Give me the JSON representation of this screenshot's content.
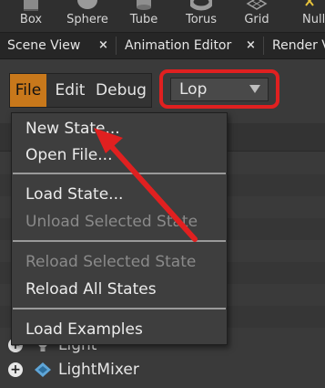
{
  "shelf": {
    "tools": [
      {
        "label": "Box",
        "icon": "box-icon"
      },
      {
        "label": "Sphere",
        "icon": "sphere-icon"
      },
      {
        "label": "Tube",
        "icon": "tube-icon"
      },
      {
        "label": "Torus",
        "icon": "torus-icon"
      },
      {
        "label": "Grid",
        "icon": "grid-icon"
      },
      {
        "label": "Null",
        "icon": "null-icon"
      }
    ]
  },
  "tabs": [
    {
      "label": "Scene View",
      "close": "×"
    },
    {
      "label": "Animation Editor",
      "close": "×"
    },
    {
      "label": "Render V"
    }
  ],
  "menubar": {
    "items": [
      "File",
      "Edit",
      "Debug"
    ],
    "active": "File"
  },
  "context_select": {
    "value": "Lop"
  },
  "file_menu": {
    "items": [
      {
        "label": "New State...",
        "enabled": true
      },
      {
        "label": "Open File...",
        "enabled": true
      },
      {
        "label": "Load State...",
        "enabled": true
      },
      {
        "label": "Unload Selected State",
        "enabled": false
      },
      {
        "label": "Reload Selected State",
        "enabled": false
      },
      {
        "label": "Reload All States",
        "enabled": true
      },
      {
        "label": "Load Examples",
        "enabled": true
      }
    ]
  },
  "tree": {
    "items": [
      {
        "label": "Light",
        "icon": "light-bulb-icon"
      },
      {
        "label": "LightMixer",
        "icon": "light-mixer-icon"
      }
    ],
    "expander_symbol": "+"
  },
  "colors": {
    "active_menu": "#c8781b",
    "annotation_red": "#e02020",
    "background": "#3a3a3a"
  }
}
